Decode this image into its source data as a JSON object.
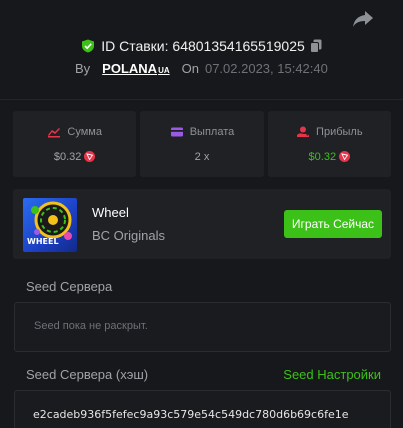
{
  "header": {
    "bet_id_label": "ID Ставки: 64801354165519025",
    "by_label": "By",
    "username": "POLANA",
    "username_suffix": "UA",
    "on_label": "On",
    "datetime": "07.02.2023, 15:42:40"
  },
  "stats": [
    {
      "label": "Сумма",
      "value": "$0.32",
      "icon": "bet-amount-icon"
    },
    {
      "label": "Выплата",
      "value": "2 x",
      "icon": "payout-card-icon"
    },
    {
      "label": "Прибыль",
      "value": "$0.32",
      "icon": "profit-hand-icon"
    }
  ],
  "game": {
    "thumbnail_label": "WHEEL",
    "name": "Wheel",
    "provider": "BC Originals",
    "play_button": "Играть Сейчас"
  },
  "seeds": {
    "server_seed_label": "Seed Сервера",
    "server_seed_value": "Seed пока не раскрыт.",
    "hash_label": "Seed Сервера (хэш)",
    "settings_link": "Seed Настройки",
    "hash_value": "e2cadeb936f5fefec9a93c579e54c549dc780d6b69c6fe1e"
  },
  "colors": {
    "background": "#17181b",
    "panel": "#1f2125",
    "accent_green": "#3bc117",
    "tron_red": "#e8344a"
  }
}
